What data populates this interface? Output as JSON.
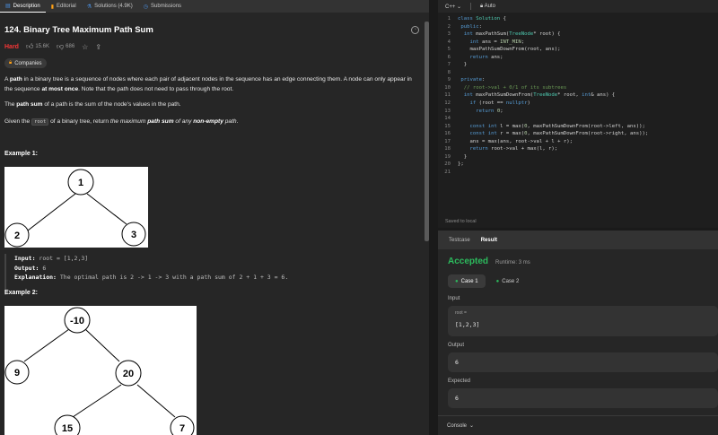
{
  "left_tabs": [
    {
      "label": "Description",
      "icon": "description-icon"
    },
    {
      "label": "Editorial",
      "icon": "book-icon"
    },
    {
      "label": "Solutions (4.9K)",
      "icon": "flask-icon"
    },
    {
      "label": "Submissions",
      "icon": "clock-icon"
    }
  ],
  "problem": {
    "title": "124. Binary Tree Maximum Path Sum",
    "difficulty": "Hard",
    "likes": "15.6K",
    "dislikes": "686",
    "companies_label": "Companies",
    "p1_a": "A ",
    "p1_b": "path",
    "p1_c": " in a binary tree is a sequence of nodes where each pair of adjacent nodes in the sequence has an edge connecting them. A node can only appear in the sequence ",
    "p1_d": "at most once",
    "p1_e": ". Note that the path does not need to pass through the root.",
    "p2_a": "The ",
    "p2_b": "path sum",
    "p2_c": " of a path is the sum of the node's values in the path.",
    "p3_a": "Given the ",
    "p3_code": "root",
    "p3_b": " of a binary tree, return ",
    "p3_c": "the maximum ",
    "p3_d": "path sum",
    "p3_e": " of any ",
    "p3_f": "non-empty",
    "p3_g": " path",
    "p3_h": "."
  },
  "example1": {
    "title": "Example 1:",
    "nodes": [
      "1",
      "2",
      "3"
    ],
    "input_label": "Input:",
    "input_value": "root = [1,2,3]",
    "output_label": "Output:",
    "output_value": "6",
    "explanation_label": "Explanation:",
    "explanation_value": "The optimal path is 2 -> 1 -> 3 with a path sum of 2 + 1 + 3 = 6."
  },
  "example2": {
    "title": "Example 2:",
    "nodes": [
      "-10",
      "9",
      "20",
      "15",
      "7"
    ]
  },
  "editor": {
    "language": "C++",
    "mode": "Auto",
    "saved_label": "Saved to local",
    "lines": [
      "class Solution {",
      " public:",
      "  int maxPathSum(TreeNode* root) {",
      "    int ans = INT_MIN;",
      "    maxPathSumDownFrom(root, ans);",
      "    return ans;",
      "  }",
      "",
      " private:",
      "  // root->val + 0/1 of its subtrees",
      "  int maxPathSumDownFrom(TreeNode* root, int& ans) {",
      "    if (root == nullptr)",
      "      return 0;",
      "",
      "    const int l = max(0, maxPathSumDownFrom(root->left, ans));",
      "    const int r = max(0, maxPathSumDownFrom(root->right, ans));",
      "    ans = max(ans, root->val + l + r);",
      "    return root->val + max(l, r);",
      "  }",
      "};",
      ""
    ]
  },
  "result": {
    "tabs": [
      "Testcase",
      "Result"
    ],
    "status": "Accepted",
    "runtime": "Runtime: 3 ms",
    "cases": [
      "Case 1",
      "Case 2"
    ],
    "input_label": "Input",
    "input_var": "root =",
    "input_value": "[1,2,3]",
    "output_label": "Output",
    "output_value": "6",
    "expected_label": "Expected",
    "expected_value": "6",
    "console_label": "Console"
  },
  "colors": {
    "accent": "#ffa116",
    "hard": "#f63636",
    "accepted": "#2cbb5d"
  }
}
